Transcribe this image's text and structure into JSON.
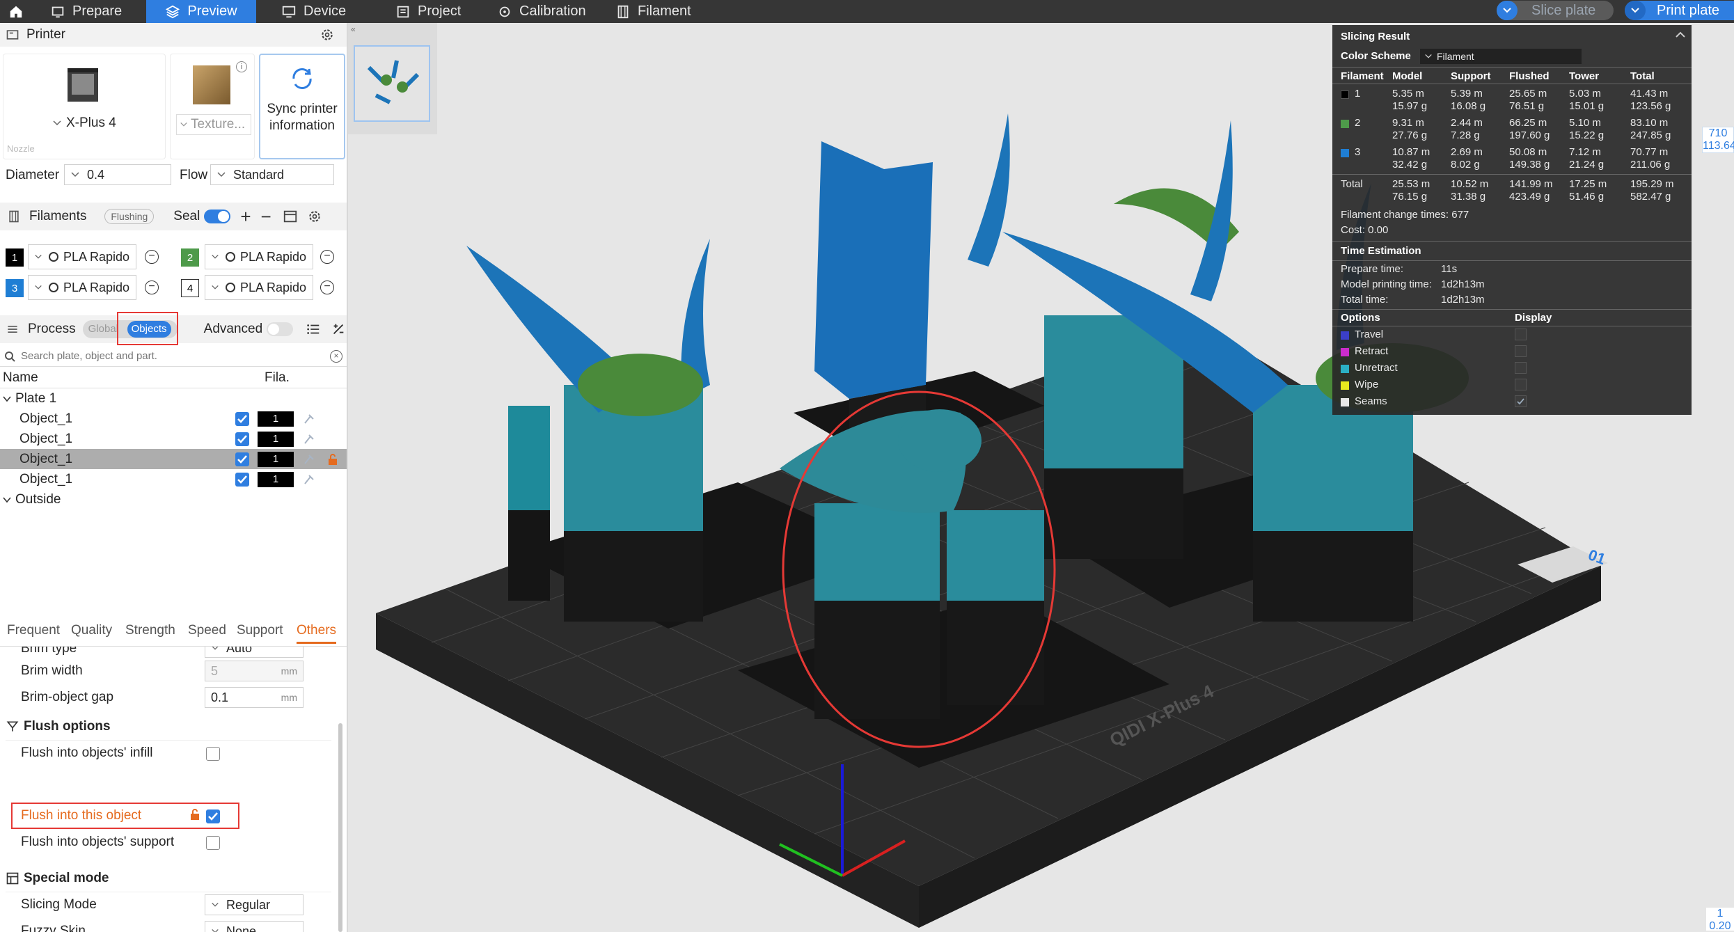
{
  "topbar": {
    "tabs": [
      {
        "label": "Prepare"
      },
      {
        "label": "Preview"
      },
      {
        "label": "Device"
      },
      {
        "label": "Project"
      },
      {
        "label": "Calibration"
      },
      {
        "label": "Filament"
      }
    ],
    "active_tab": "Preview",
    "slice_plate_label": "Slice plate",
    "print_plate_label": "Print plate",
    "colors": {
      "bar": "#363636",
      "accent": "#2f7ee0"
    }
  },
  "printer": {
    "title": "Printer",
    "model_name": "X-Plus 4",
    "texture_label": "Texture...",
    "sync_label_1": "Sync printer",
    "sync_label_2": "information",
    "nozzle_label": "Nozzle",
    "diameter_label": "Diameter",
    "diameter_value": "0.4",
    "flow_label": "Flow",
    "flow_value": "Standard"
  },
  "filaments": {
    "title": "Filaments",
    "flushing_label": "Flushing",
    "seal_label": "Seal",
    "items": [
      {
        "num": "1",
        "name": "PLA Rapido",
        "color": "#000000"
      },
      {
        "num": "2",
        "name": "PLA Rapido",
        "color": "#4e9a4a"
      },
      {
        "num": "3",
        "name": "PLA Rapido",
        "color": "#1f7ed4"
      },
      {
        "num": "4",
        "name": "PLA Rapido",
        "color": "#ffffff"
      }
    ]
  },
  "process": {
    "title": "Process",
    "global_label": "Global",
    "objects_label": "Objects",
    "advanced_label": "Advanced",
    "search_placeholder": "Search plate, object and part."
  },
  "object_list": {
    "col_name": "Name",
    "col_fila": "Fila.",
    "plate_label": "Plate 1",
    "objects": [
      {
        "name": "Object_1",
        "fila": "1"
      },
      {
        "name": "Object_1",
        "fila": "1"
      },
      {
        "name": "Object_1",
        "fila": "1"
      },
      {
        "name": "Object_1",
        "fila": "1"
      }
    ],
    "outside_label": "Outside"
  },
  "settings_tabs": [
    "Frequent",
    "Quality",
    "Strength",
    "Speed",
    "Support",
    "Others"
  ],
  "settings_active_tab": "Others",
  "settings": {
    "brim_type_label": "Brim type",
    "brim_type_value": "Auto",
    "brim_width_label": "Brim width",
    "brim_width_value": "5",
    "brim_gap_label": "Brim-object gap",
    "brim_gap_value": "0.1",
    "unit_mm": "mm",
    "flush_section": "Flush options",
    "flush_infill_label": "Flush into objects' infill",
    "flush_this_label": "Flush into this object",
    "flush_support_label": "Flush into objects' support",
    "special_section": "Special mode",
    "slicing_mode_label": "Slicing Mode",
    "slicing_mode_value": "Regular",
    "fuzzy_label": "Fuzzy Skin",
    "fuzzy_value": "None"
  },
  "slicing_result": {
    "title": "Slicing Result",
    "color_scheme_label": "Color Scheme",
    "color_scheme_value": "Filament",
    "headers": [
      "Filament",
      "Model",
      "Support",
      "Flushed",
      "Tower",
      "Total"
    ],
    "rows": [
      {
        "id": "1",
        "color": "#000000",
        "model_m": "5.35 m",
        "model_g": "15.97 g",
        "support_m": "5.39 m",
        "support_g": "16.08 g",
        "flushed_m": "25.65 m",
        "flushed_g": "76.51 g",
        "tower_m": "5.03 m",
        "tower_g": "15.01 g",
        "total_m": "41.43 m",
        "total_g": "123.56 g"
      },
      {
        "id": "2",
        "color": "#4e9a4a",
        "model_m": "9.31 m",
        "model_g": "27.76 g",
        "support_m": "2.44 m",
        "support_g": "7.28 g",
        "flushed_m": "66.25 m",
        "flushed_g": "197.60 g",
        "tower_m": "5.10 m",
        "tower_g": "15.22 g",
        "total_m": "83.10 m",
        "total_g": "247.85 g"
      },
      {
        "id": "3",
        "color": "#1f7ed4",
        "model_m": "10.87 m",
        "model_g": "32.42 g",
        "support_m": "2.69 m",
        "support_g": "8.02 g",
        "flushed_m": "50.08 m",
        "flushed_g": "149.38 g",
        "tower_m": "7.12 m",
        "tower_g": "21.24 g",
        "total_m": "70.77 m",
        "total_g": "211.06 g"
      }
    ],
    "total": {
      "label": "Total",
      "model_m": "25.53 m",
      "model_g": "76.15 g",
      "support_m": "10.52 m",
      "support_g": "31.38 g",
      "flushed_m": "141.99 m",
      "flushed_g": "423.49 g",
      "tower_m": "17.25 m",
      "tower_g": "51.46 g",
      "total_m": "195.29 m",
      "total_g": "582.47 g"
    },
    "change_times": "Filament change times:  677",
    "cost": "Cost:  0.00",
    "time_title": "Time Estimation",
    "prepare_label": "Prepare time:",
    "prepare_value": "11s",
    "model_time_label": "Model printing time:",
    "model_time_value": "1d2h13m",
    "total_time_label": "Total time:",
    "total_time_value": "1d2h13m",
    "options_title": "Options",
    "display_title": "Display",
    "options": [
      {
        "label": "Travel",
        "color": "#3b3fc9",
        "checked": false
      },
      {
        "label": "Retract",
        "color": "#cc2ccc",
        "checked": false
      },
      {
        "label": "Unretract",
        "color": "#2bb0c4",
        "checked": false
      },
      {
        "label": "Wipe",
        "color": "#e8e81e",
        "checked": false
      },
      {
        "label": "Seams",
        "color": "#e8e8e8",
        "checked": true
      }
    ]
  },
  "viewport": {
    "bed_brand": "QIDI X-Plus 4",
    "plate_number": "01",
    "side_ruler_top_1": "710",
    "side_ruler_top_2": "113.64",
    "side_ruler_bottom_1": "1",
    "side_ruler_bottom_2": "0.20"
  }
}
